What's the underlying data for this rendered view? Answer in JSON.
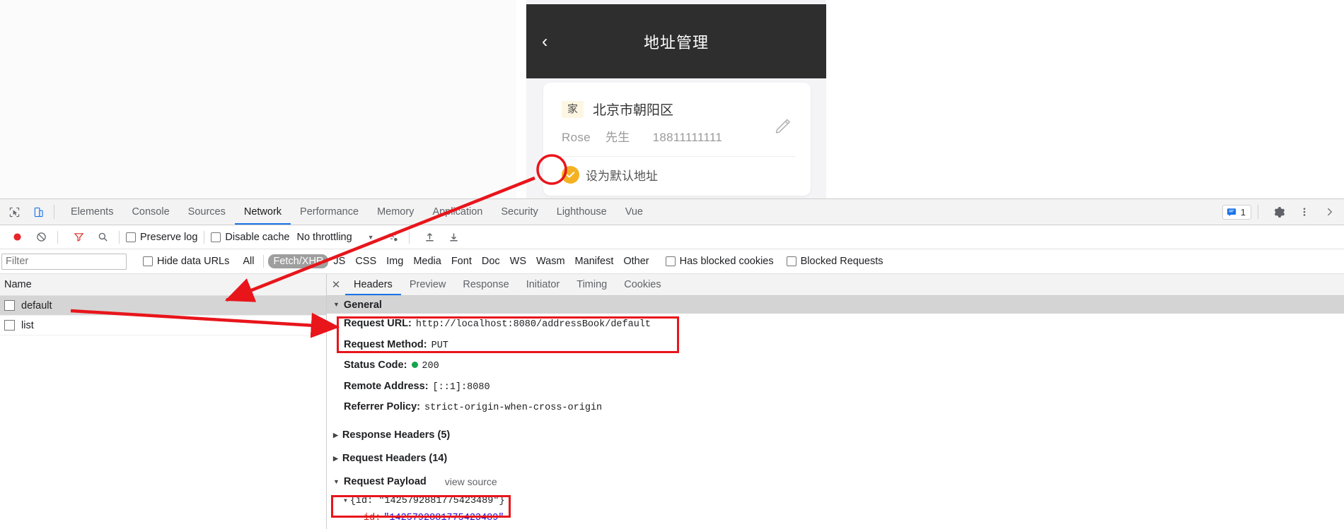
{
  "mobile": {
    "title": "地址管理",
    "back_icon": "chevron-left-icon",
    "address": {
      "tag": "家",
      "city": "北京市朝阳区",
      "contact_name": "Rose",
      "honorific": "先生",
      "phone": "18811111111",
      "edit_icon": "pencil-icon",
      "default_label": "设为默认地址",
      "default_checked": true,
      "check_color": "#f4b223",
      "tag_bg": "#fdf6e3"
    }
  },
  "devtools": {
    "inspect_icon": "inspect-cursor-icon",
    "device_icon": "device-toolbar-icon",
    "tabs": [
      {
        "label": "Elements",
        "active": false
      },
      {
        "label": "Console",
        "active": false
      },
      {
        "label": "Sources",
        "active": false
      },
      {
        "label": "Network",
        "active": true
      },
      {
        "label": "Performance",
        "active": false
      },
      {
        "label": "Memory",
        "active": false
      },
      {
        "label": "Application",
        "active": false
      },
      {
        "label": "Security",
        "active": false
      },
      {
        "label": "Lighthouse",
        "active": false
      },
      {
        "label": "Vue",
        "active": false
      }
    ],
    "issues_count": "1",
    "issues_icon": "message-icon",
    "settings_icon": "gear-icon",
    "more_icon": "kebab-menu-icon",
    "overflow_icon": "chevron-right-icon",
    "toolbar": {
      "record_icon": "record-circle-icon",
      "clear_icon": "clear-no-entry-icon",
      "filter_icon": "funnel-icon",
      "search_icon": "magnifier-icon",
      "preserve_log": "Preserve log",
      "preserve_log_checked": false,
      "disable_cache": "Disable cache",
      "disable_cache_checked": false,
      "throttling": "No throttling",
      "throttling_arrow": "▼",
      "wifi_icon": "network-conditions-icon",
      "import_icon": "upload-har-icon",
      "export_icon": "download-har-icon"
    },
    "filter": {
      "placeholder": "Filter",
      "value": "",
      "hide_data_urls": "Hide data URLs",
      "hide_data_urls_checked": false,
      "types": [
        {
          "label": "All",
          "active": false
        },
        {
          "label": "Fetch/XHR",
          "active": true
        },
        {
          "label": "JS",
          "active": false
        },
        {
          "label": "CSS",
          "active": false
        },
        {
          "label": "Img",
          "active": false
        },
        {
          "label": "Media",
          "active": false
        },
        {
          "label": "Font",
          "active": false
        },
        {
          "label": "Doc",
          "active": false
        },
        {
          "label": "WS",
          "active": false
        },
        {
          "label": "Wasm",
          "active": false
        },
        {
          "label": "Manifest",
          "active": false
        },
        {
          "label": "Other",
          "active": false
        }
      ],
      "has_blocked_cookies": "Has blocked cookies",
      "has_blocked_cookies_checked": false,
      "blocked_requests": "Blocked Requests",
      "blocked_requests_checked": false
    },
    "requests": {
      "column_header": "Name",
      "rows": [
        {
          "name": "default",
          "selected": true
        },
        {
          "name": "list",
          "selected": false
        }
      ]
    },
    "detail": {
      "close_icon": "close-icon",
      "tabs": [
        {
          "label": "Headers",
          "active": true
        },
        {
          "label": "Preview",
          "active": false
        },
        {
          "label": "Response",
          "active": false
        },
        {
          "label": "Initiator",
          "active": false
        },
        {
          "label": "Timing",
          "active": false
        },
        {
          "label": "Cookies",
          "active": false
        }
      ],
      "general_section": "General",
      "general": [
        {
          "key": "Request URL:",
          "value": "http://localhost:8080/addressBook/default"
        },
        {
          "key": "Request Method:",
          "value": "PUT"
        },
        {
          "key": "Status Code:",
          "value": "200",
          "status_dot": "#16a34a"
        },
        {
          "key": "Remote Address:",
          "value": "[::1]:8080"
        },
        {
          "key": "Referrer Policy:",
          "value": "strict-origin-when-cross-origin"
        }
      ],
      "response_headers_section": "Response Headers (5)",
      "request_headers_section": "Request Headers (14)",
      "request_payload_section": "Request Payload",
      "view_source": "view source",
      "payload_collapsed": "{id: \"1425792881775423489\"}",
      "payload_key": "id:",
      "payload_value": "\"1425792881775423489\""
    }
  },
  "annotations": {
    "highlight_color": "#e8151b",
    "boxes": [
      "request-url-and-method",
      "request-payload-object",
      "default-address-checkmark"
    ],
    "arrows": [
      "checkmark-to-default-request",
      "checkmark-to-request-url"
    ]
  }
}
